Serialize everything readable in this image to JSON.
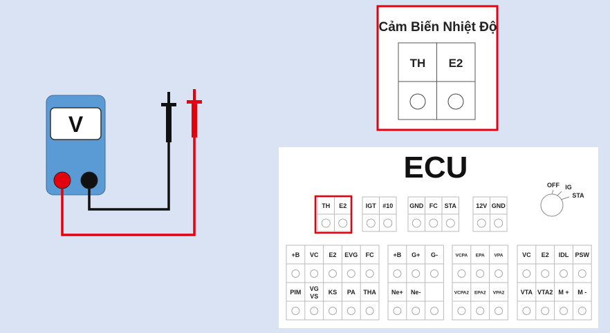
{
  "meter": {
    "display_label": "V"
  },
  "sensor": {
    "title": "Cảm Biến Nhiệt Độ",
    "pins": [
      "TH",
      "E2"
    ]
  },
  "ecu": {
    "title": "ECU",
    "ignition": {
      "off": "OFF",
      "ig": "IG",
      "sta": "STA"
    },
    "top_groups": [
      [
        "TH",
        "E2"
      ],
      [
        "IGT",
        "#10"
      ],
      [
        "GND",
        "FC",
        "STA"
      ],
      [
        "12V",
        "GND"
      ]
    ],
    "bottom_groups": [
      {
        "row1": [
          "+B",
          "VC",
          "E2",
          "EVG",
          "FC"
        ],
        "row2": [
          "PIM",
          "VG VS",
          "KS",
          "PA",
          "THA"
        ]
      },
      {
        "row1": [
          "+B",
          "G+",
          "G-"
        ],
        "row2": [
          "Ne+",
          "Ne-",
          ""
        ]
      },
      {
        "row1": [
          "VCPA",
          "EPA",
          "VPA"
        ],
        "row2": [
          "VCPA2",
          "EPA2",
          "VPA2"
        ]
      },
      {
        "row1": [
          "VC",
          "E2",
          "IDL",
          "PSW"
        ],
        "row2": [
          "VTA",
          "VTA2",
          "M +",
          "M -"
        ]
      }
    ]
  },
  "colors": {
    "background": "#dae3f3",
    "meter_body": "#5b9bd5",
    "red": "#e3000f",
    "black": "#111111",
    "highlight": "#e3000f"
  }
}
